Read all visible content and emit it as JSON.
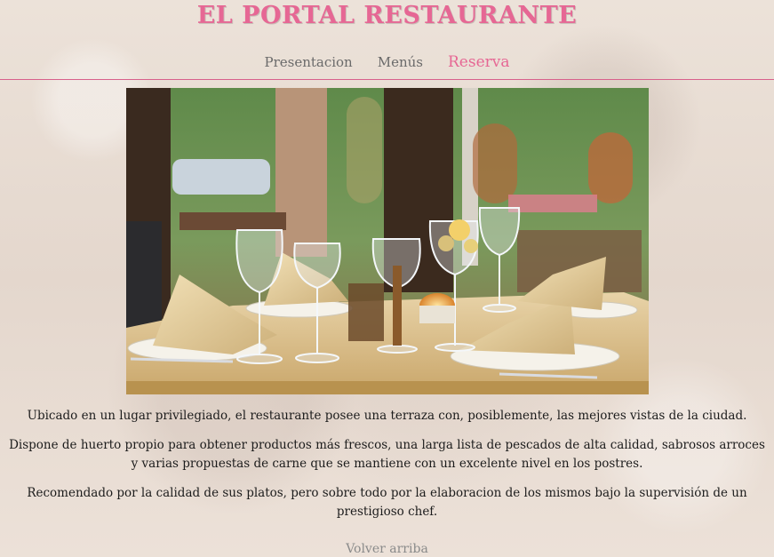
{
  "header": {
    "title": "EL PORTAL RESTAURANTE"
  },
  "nav": {
    "items": [
      {
        "label": "Presentacion",
        "active": false
      },
      {
        "label": "Menús",
        "active": false
      },
      {
        "label": "Reserva",
        "active": true
      }
    ]
  },
  "colors": {
    "accent": "#e66794",
    "nav_text": "#6a6a6a",
    "background": "#e9ddd3"
  },
  "hero": {
    "image_subject": "restaurant-table-photo"
  },
  "content": {
    "paragraphs": [
      "Ubicado en un lugar privilegiado, el restaurante posee una terraza con, posiblemente, las mejores vistas de la ciudad.",
      "Dispone de huerto propio para obtener productos más frescos, una larga lista de pescados de alta calidad, sabrosos arroces y varias propuestas de carne que se mantiene con un excelente nivel en los postres.",
      "Recomendado por la calidad de sus platos, pero sobre todo por la elaboracion de los mismos bajo la supervisión de un prestigioso chef."
    ]
  },
  "footer": {
    "back_to_top": "Volver arriba"
  }
}
